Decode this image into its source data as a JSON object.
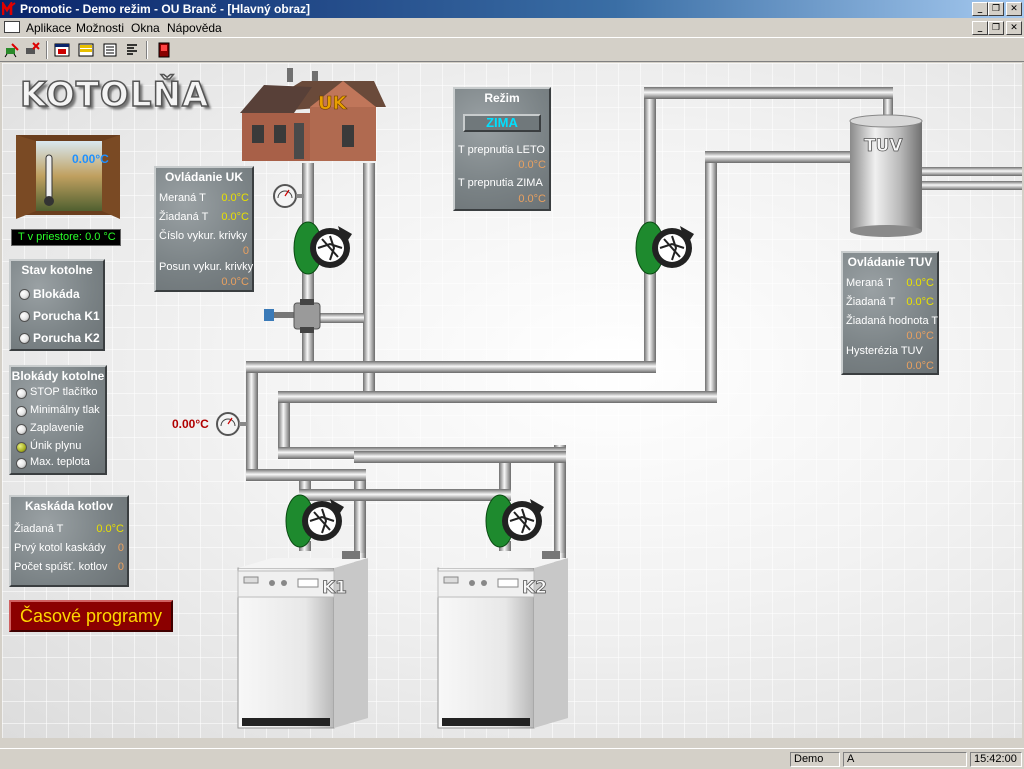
{
  "window": {
    "title": "Promotic - Demo režim - OU Branč - [Hlavný obraz]"
  },
  "menu": {
    "items": [
      "Aplikace",
      "Možnosti",
      "Okna",
      "Nápověda"
    ]
  },
  "toolbar": {
    "icons": [
      "run-icon",
      "stop-icon",
      "window-icon",
      "table-icon",
      "list-icon",
      "text-icon",
      "exit-icon"
    ]
  },
  "scene": {
    "logo": "KOTOLŇA",
    "building_label": "UK",
    "tank_label": "TUV",
    "boiler1_label": "K1",
    "boiler2_label": "K2",
    "pipe_temp": "0.00°C",
    "outside_temp": "0.00°C",
    "room_temp_label": "T v priestore:",
    "room_temp_value": "0.0 °C"
  },
  "rezim": {
    "title": "Režim",
    "mode_button": "ZIMA",
    "leto_label": "T prepnutia LETO",
    "leto_value": "0.0°C",
    "zima_label": "T prepnutia ZIMA",
    "zima_value": "0.0°C"
  },
  "ovladanie_uk": {
    "title": "Ovládanie UK",
    "rows": [
      {
        "label": "Meraná T",
        "value": "0.0°C"
      },
      {
        "label": "Žiadaná T",
        "value": "0.0°C"
      },
      {
        "label": "Číslo vykur. krivky",
        "value": "0"
      },
      {
        "label": "Posun vykur. krivky",
        "value": "0.0°C"
      }
    ]
  },
  "ovladanie_tuv": {
    "title": "Ovládanie TUV",
    "rows": [
      {
        "label": "Meraná T",
        "value": "0.0°C"
      },
      {
        "label": "Žiadaná T",
        "value": "0.0°C"
      },
      {
        "label": "Žiadaná hodnota T",
        "value": "0.0°C"
      },
      {
        "label": "Hysterézia TUV",
        "value": "0.0°C"
      }
    ]
  },
  "stav_kotolne": {
    "title": "Stav kotolne",
    "items": [
      "Blokáda",
      "Porucha K1",
      "Porucha K2"
    ]
  },
  "blokady": {
    "title": "Blokády kotolne",
    "items": [
      "STOP tlačítko",
      "Minimálny tlak",
      "Zaplavenie",
      "Únik plynu",
      "Max. teplota"
    ],
    "active_index": 3
  },
  "kaskada": {
    "title": "Kaskáda kotlov",
    "rows": [
      {
        "label": "Žiadaná T",
        "value": "0.0°C"
      },
      {
        "label": "Prvý kotol kaskády",
        "value": "0"
      },
      {
        "label": "Počet spúšť. kotlov",
        "value": "0"
      }
    ]
  },
  "casove_programy": "Časové programy",
  "status": {
    "mode": "Demo",
    "flag": "A",
    "time": "15:42:00"
  },
  "colors": {
    "value_yellow": "#e8e000",
    "value_orange": "#e8a060",
    "mode_cyan": "#00e0ff",
    "alarm_red": "#8b0000",
    "pump_green": "#1e8a2e"
  }
}
